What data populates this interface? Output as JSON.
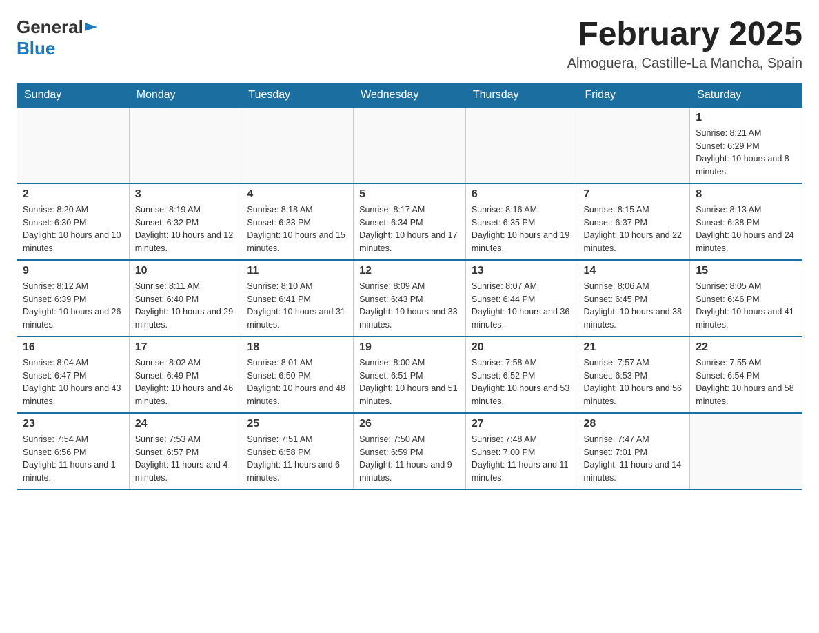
{
  "header": {
    "logo": {
      "general": "General",
      "blue": "Blue"
    },
    "title": "February 2025",
    "subtitle": "Almoguera, Castille-La Mancha, Spain"
  },
  "days_of_week": [
    "Sunday",
    "Monday",
    "Tuesday",
    "Wednesday",
    "Thursday",
    "Friday",
    "Saturday"
  ],
  "weeks": [
    [
      {
        "day": "",
        "info": ""
      },
      {
        "day": "",
        "info": ""
      },
      {
        "day": "",
        "info": ""
      },
      {
        "day": "",
        "info": ""
      },
      {
        "day": "",
        "info": ""
      },
      {
        "day": "",
        "info": ""
      },
      {
        "day": "1",
        "info": "Sunrise: 8:21 AM\nSunset: 6:29 PM\nDaylight: 10 hours and 8 minutes."
      }
    ],
    [
      {
        "day": "2",
        "info": "Sunrise: 8:20 AM\nSunset: 6:30 PM\nDaylight: 10 hours and 10 minutes."
      },
      {
        "day": "3",
        "info": "Sunrise: 8:19 AM\nSunset: 6:32 PM\nDaylight: 10 hours and 12 minutes."
      },
      {
        "day": "4",
        "info": "Sunrise: 8:18 AM\nSunset: 6:33 PM\nDaylight: 10 hours and 15 minutes."
      },
      {
        "day": "5",
        "info": "Sunrise: 8:17 AM\nSunset: 6:34 PM\nDaylight: 10 hours and 17 minutes."
      },
      {
        "day": "6",
        "info": "Sunrise: 8:16 AM\nSunset: 6:35 PM\nDaylight: 10 hours and 19 minutes."
      },
      {
        "day": "7",
        "info": "Sunrise: 8:15 AM\nSunset: 6:37 PM\nDaylight: 10 hours and 22 minutes."
      },
      {
        "day": "8",
        "info": "Sunrise: 8:13 AM\nSunset: 6:38 PM\nDaylight: 10 hours and 24 minutes."
      }
    ],
    [
      {
        "day": "9",
        "info": "Sunrise: 8:12 AM\nSunset: 6:39 PM\nDaylight: 10 hours and 26 minutes."
      },
      {
        "day": "10",
        "info": "Sunrise: 8:11 AM\nSunset: 6:40 PM\nDaylight: 10 hours and 29 minutes."
      },
      {
        "day": "11",
        "info": "Sunrise: 8:10 AM\nSunset: 6:41 PM\nDaylight: 10 hours and 31 minutes."
      },
      {
        "day": "12",
        "info": "Sunrise: 8:09 AM\nSunset: 6:43 PM\nDaylight: 10 hours and 33 minutes."
      },
      {
        "day": "13",
        "info": "Sunrise: 8:07 AM\nSunset: 6:44 PM\nDaylight: 10 hours and 36 minutes."
      },
      {
        "day": "14",
        "info": "Sunrise: 8:06 AM\nSunset: 6:45 PM\nDaylight: 10 hours and 38 minutes."
      },
      {
        "day": "15",
        "info": "Sunrise: 8:05 AM\nSunset: 6:46 PM\nDaylight: 10 hours and 41 minutes."
      }
    ],
    [
      {
        "day": "16",
        "info": "Sunrise: 8:04 AM\nSunset: 6:47 PM\nDaylight: 10 hours and 43 minutes."
      },
      {
        "day": "17",
        "info": "Sunrise: 8:02 AM\nSunset: 6:49 PM\nDaylight: 10 hours and 46 minutes."
      },
      {
        "day": "18",
        "info": "Sunrise: 8:01 AM\nSunset: 6:50 PM\nDaylight: 10 hours and 48 minutes."
      },
      {
        "day": "19",
        "info": "Sunrise: 8:00 AM\nSunset: 6:51 PM\nDaylight: 10 hours and 51 minutes."
      },
      {
        "day": "20",
        "info": "Sunrise: 7:58 AM\nSunset: 6:52 PM\nDaylight: 10 hours and 53 minutes."
      },
      {
        "day": "21",
        "info": "Sunrise: 7:57 AM\nSunset: 6:53 PM\nDaylight: 10 hours and 56 minutes."
      },
      {
        "day": "22",
        "info": "Sunrise: 7:55 AM\nSunset: 6:54 PM\nDaylight: 10 hours and 58 minutes."
      }
    ],
    [
      {
        "day": "23",
        "info": "Sunrise: 7:54 AM\nSunset: 6:56 PM\nDaylight: 11 hours and 1 minute."
      },
      {
        "day": "24",
        "info": "Sunrise: 7:53 AM\nSunset: 6:57 PM\nDaylight: 11 hours and 4 minutes."
      },
      {
        "day": "25",
        "info": "Sunrise: 7:51 AM\nSunset: 6:58 PM\nDaylight: 11 hours and 6 minutes."
      },
      {
        "day": "26",
        "info": "Sunrise: 7:50 AM\nSunset: 6:59 PM\nDaylight: 11 hours and 9 minutes."
      },
      {
        "day": "27",
        "info": "Sunrise: 7:48 AM\nSunset: 7:00 PM\nDaylight: 11 hours and 11 minutes."
      },
      {
        "day": "28",
        "info": "Sunrise: 7:47 AM\nSunset: 7:01 PM\nDaylight: 11 hours and 14 minutes."
      },
      {
        "day": "",
        "info": ""
      }
    ]
  ]
}
